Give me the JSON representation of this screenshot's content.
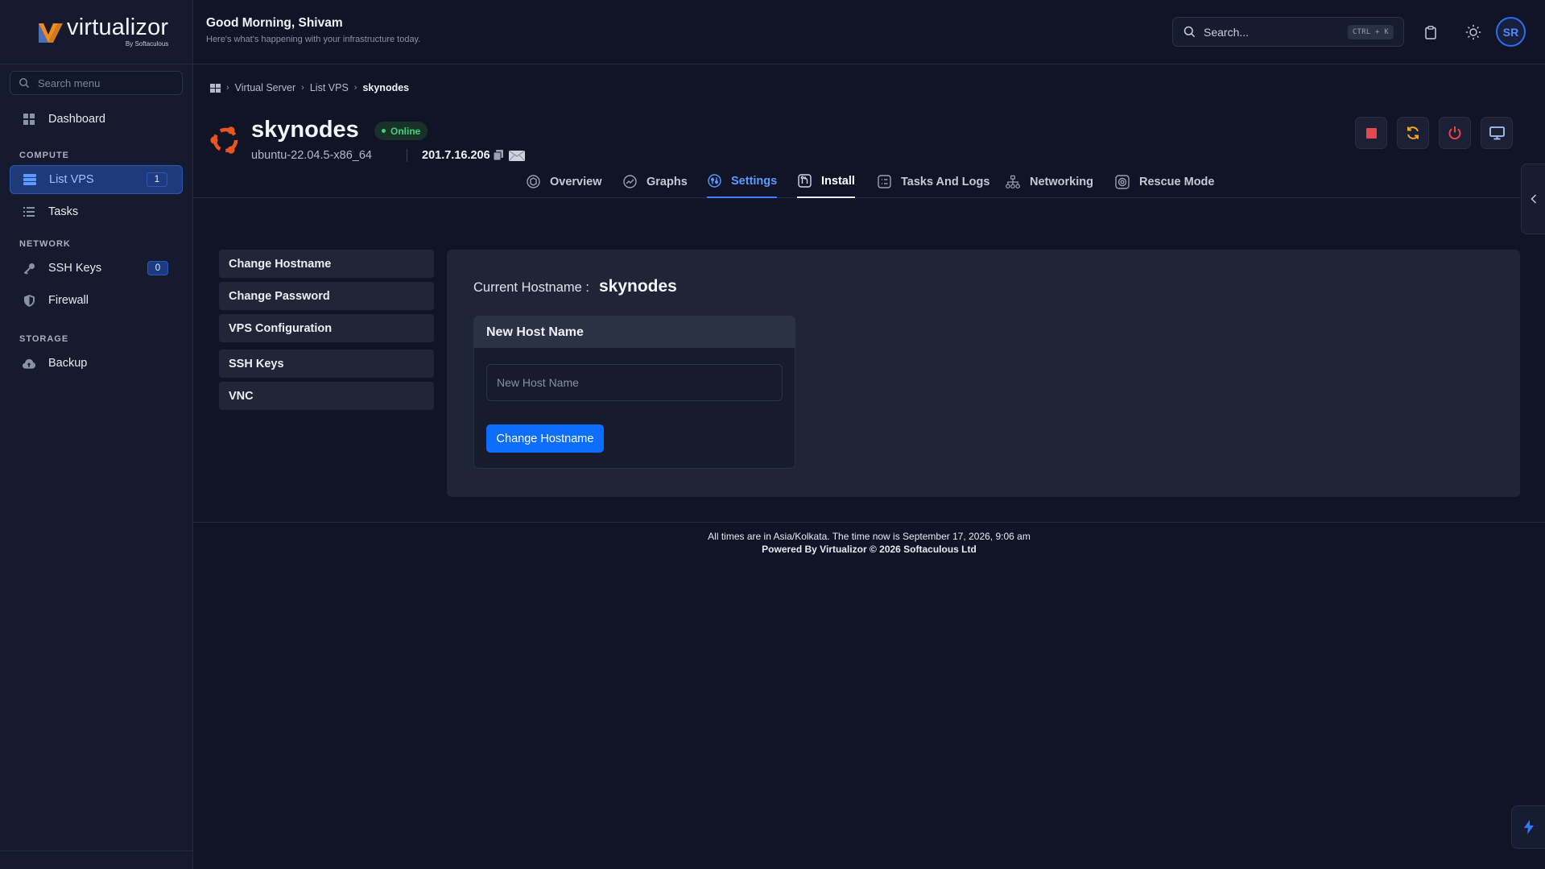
{
  "brand": {
    "name": "virtualizor",
    "sub": "By Softaculous"
  },
  "sidebar": {
    "search_placeholder": "Search menu",
    "dashboard": "Dashboard",
    "sections": {
      "compute": "COMPUTE",
      "network": "NETWORK",
      "storage": "STORAGE"
    },
    "items": {
      "list_vps": {
        "label": "List VPS",
        "badge": "1"
      },
      "tasks": {
        "label": "Tasks"
      },
      "ssh_keys": {
        "label": "SSH Keys",
        "badge": "0"
      },
      "firewall": {
        "label": "Firewall"
      },
      "backup": {
        "label": "Backup"
      }
    }
  },
  "header": {
    "greeting": "Good Morning, Shivam",
    "subtitle": "Here's what's happening with your infrastructure today.",
    "search_placeholder": "Search...",
    "shortcut": "CTRL + K",
    "avatar_initials": "SR"
  },
  "breadcrumb": [
    "Virtual Server",
    "List VPS",
    "skynodes"
  ],
  "vps": {
    "name": "skynodes",
    "status": "Online",
    "os": "ubuntu-22.04.5-x86_64",
    "ip": "201.7.16.206"
  },
  "tabs": [
    "Overview",
    "Graphs",
    "Settings",
    "Install",
    "Tasks And Logs",
    "Networking",
    "Rescue Mode"
  ],
  "settings_menu": [
    "Change Hostname",
    "Change Password",
    "VPS Configuration",
    "SSH Keys",
    "VNC"
  ],
  "hostname_panel": {
    "current_label": "Current Hostname :",
    "current_value": "skynodes",
    "card_title": "New Host Name",
    "input_placeholder": "New Host Name",
    "input_value": "",
    "submit_label": "Change Hostname"
  },
  "footer": {
    "line1": "All times are in Asia/Kolkata. The time now is September 17, 2026, 9:06 am",
    "line2": "Powered By Virtualizor © 2026 Softaculous Ltd"
  },
  "colors": {
    "accent": "#0d6efd",
    "online": "#3fd17c",
    "stop": "#e5484d",
    "restart": "#f5a524",
    "power": "#ef4444",
    "ubuntu": "#e95420"
  }
}
